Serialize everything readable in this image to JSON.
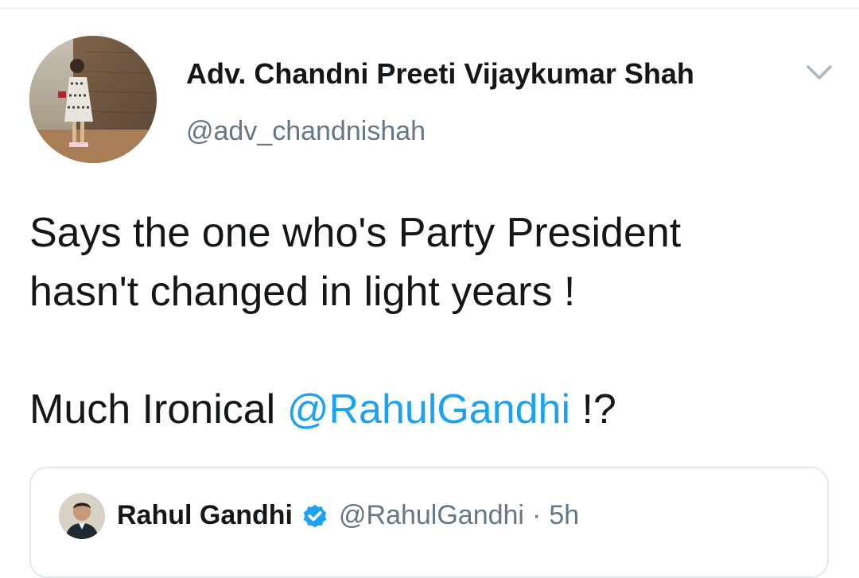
{
  "tweet": {
    "author": {
      "name": "Adv. Chandni Preeti Vijaykumar Shah",
      "handle": "@adv_chandnishah"
    },
    "text": {
      "line1": "Says the one who's Party President",
      "line2": "hasn't changed in light years !",
      "line3_prefix": "Much Ironical ",
      "mention": "@RahulGandhi",
      "line3_suffix": " !?"
    },
    "menu_icon": "chevron-down-icon"
  },
  "quoted_tweet": {
    "author_name": "Rahul Gandhi",
    "verified_icon": "verified-badge-icon",
    "handle": "@RahulGandhi",
    "separator": "·",
    "time": "5h"
  },
  "colors": {
    "link": "#1da1f2",
    "secondary_text": "#657786",
    "primary_text": "#14171a",
    "border": "#e1e8ed"
  }
}
